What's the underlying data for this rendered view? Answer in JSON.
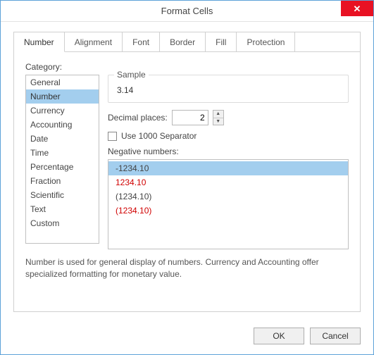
{
  "title": "Format Cells",
  "close_glyph": "✕",
  "tabs": [
    "Number",
    "Alignment",
    "Font",
    "Border",
    "Fill",
    "Protection"
  ],
  "active_tab": 0,
  "category_label": "Category:",
  "categories": [
    "General",
    "Number",
    "Currency",
    "Accounting",
    "Date",
    "Time",
    "Percentage",
    "Fraction",
    "Scientific",
    "Text",
    "Custom"
  ],
  "selected_category": 1,
  "sample": {
    "legend": "Sample",
    "value": "3.14"
  },
  "decimal": {
    "label": "Decimal places:",
    "value": "2"
  },
  "separator": {
    "label": "Use 1000 Separator",
    "checked": false
  },
  "negative": {
    "label": "Negative numbers:",
    "items": [
      {
        "text": "-1234.10",
        "red": false
      },
      {
        "text": "1234.10",
        "red": true
      },
      {
        "text": "(1234.10)",
        "red": false
      },
      {
        "text": "(1234.10)",
        "red": true
      }
    ],
    "selected": 0
  },
  "description": "Number is used for general display of numbers. Currency and Accounting offer specialized formatting for monetary value.",
  "buttons": {
    "ok": "OK",
    "cancel": "Cancel"
  }
}
